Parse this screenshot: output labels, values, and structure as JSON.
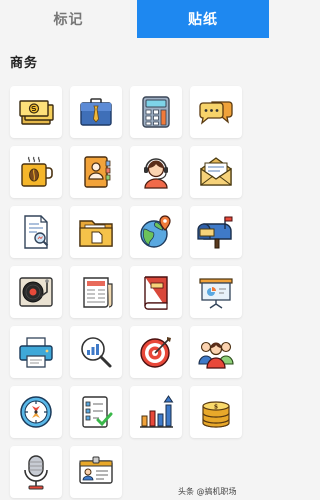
{
  "tabs": {
    "marks": "标记",
    "stickers": "贴纸"
  },
  "section": {
    "title": "商务"
  },
  "stickers": [
    {
      "icon": "money-stack-icon"
    },
    {
      "icon": "briefcase-icon"
    },
    {
      "icon": "calculator-icon"
    },
    {
      "icon": "chat-bubbles-icon"
    },
    {
      "icon": "coffee-mug-icon"
    },
    {
      "icon": "contact-book-icon"
    },
    {
      "icon": "support-agent-icon"
    },
    {
      "icon": "open-envelope-icon"
    },
    {
      "icon": "document-search-icon"
    },
    {
      "icon": "folder-icon"
    },
    {
      "icon": "globe-location-icon"
    },
    {
      "icon": "mailbox-icon"
    },
    {
      "icon": "record-player-icon"
    },
    {
      "icon": "newspaper-icon"
    },
    {
      "icon": "book-icon"
    },
    {
      "icon": "presentation-board-icon"
    },
    {
      "icon": "printer-icon"
    },
    {
      "icon": "analytics-magnifier-icon"
    },
    {
      "icon": "target-icon"
    },
    {
      "icon": "team-icon"
    },
    {
      "icon": "compass-icon"
    },
    {
      "icon": "checklist-icon"
    },
    {
      "icon": "growth-chart-icon"
    },
    {
      "icon": "coin-stack-icon"
    },
    {
      "icon": "microphone-icon"
    },
    {
      "icon": "id-card-icon"
    }
  ],
  "watermark": {
    "text": "头条 @搞机职场"
  }
}
